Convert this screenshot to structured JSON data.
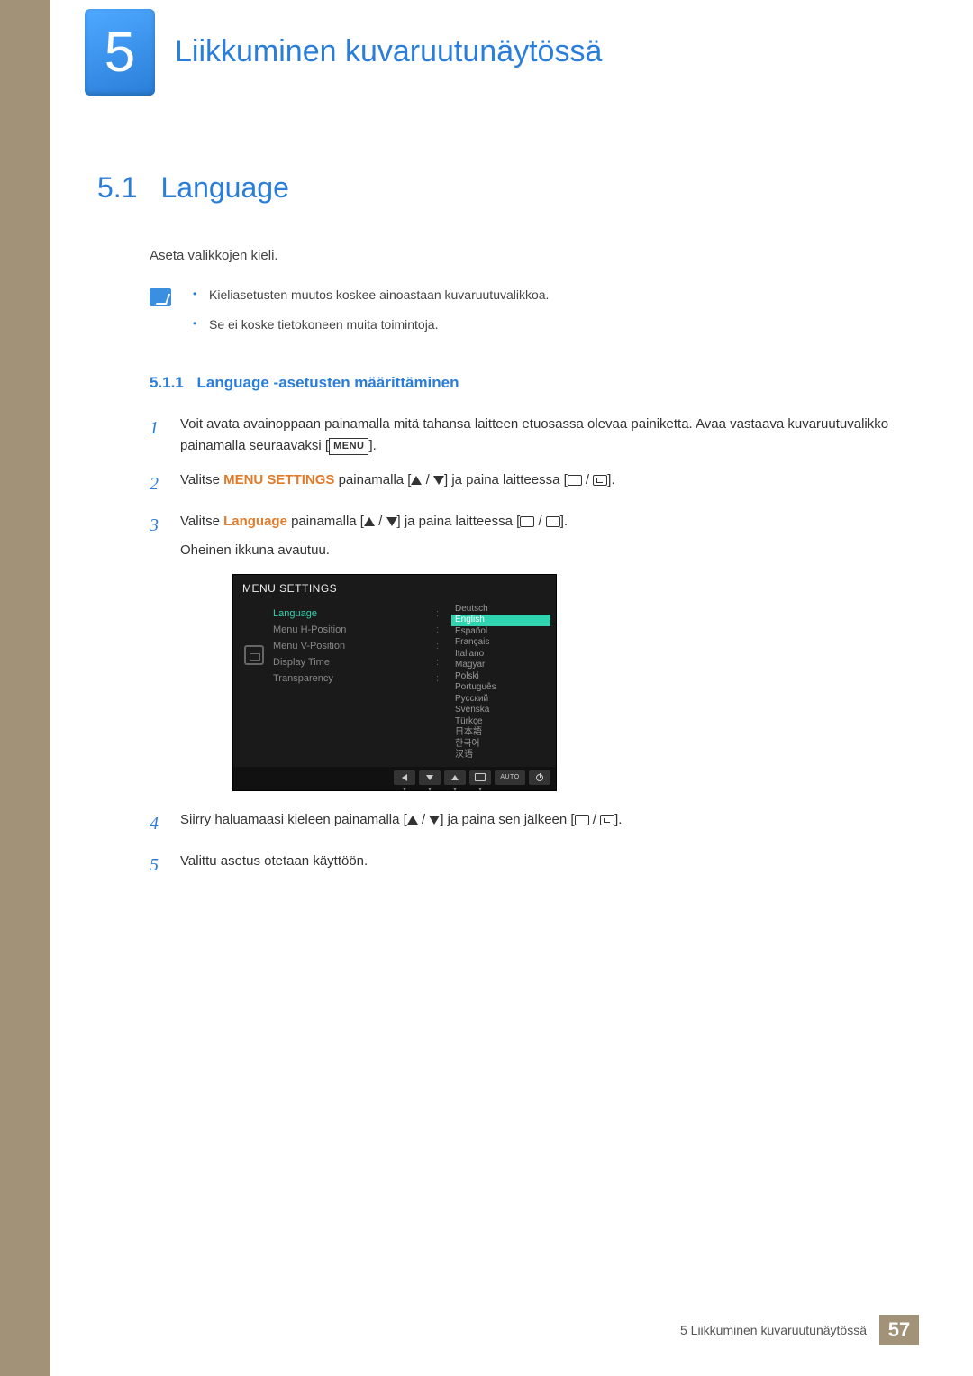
{
  "chapter": {
    "number": "5",
    "title": "Liikkuminen kuvaruutunäytössä"
  },
  "section": {
    "number": "5.1",
    "title": "Language"
  },
  "intro": "Aseta valikkojen kieli.",
  "notes": [
    "Kieliasetusten muutos koskee ainoastaan kuvaruutuvalikkoa.",
    "Se ei koske tietokoneen muita toimintoja."
  ],
  "subsection": {
    "number": "5.1.1",
    "title": "Language -asetusten määrittäminen"
  },
  "steps": {
    "s1a": "Voit avata avainoppaan painamalla mitä tahansa laitteen etuosassa olevaa painiketta. Avaa vastaava kuvaruutuvalikko painamalla seuraavaksi [",
    "s1b": "].",
    "menu_key": "MENU",
    "s2a": "Valitse ",
    "s2_bold": "MENU SETTINGS",
    "s2b": " painamalla [",
    "s2c": "] ja paina laitteessa [",
    "s2d": "].",
    "s3a": "Valitse ",
    "s3_bold": "Language",
    "s3b": " painamalla [",
    "s3c": "] ja paina laitteessa [",
    "s3d": "].",
    "s3e": "Oheinen ikkuna avautuu.",
    "s4a": "Siirry haluamaasi kieleen painamalla [",
    "s4b": "] ja paina sen jälkeen [",
    "s4c": "].",
    "s5": "Valittu asetus otetaan käyttöön."
  },
  "osd": {
    "title": "MENU SETTINGS",
    "items": [
      "Language",
      "Menu H-Position",
      "Menu V-Position",
      "Display Time",
      "Transparency"
    ],
    "langs": [
      "Deutsch",
      "English",
      "Español",
      "Français",
      "Italiano",
      "Magyar",
      "Polski",
      "Português",
      "Русский",
      "Svenska",
      "Türkçe",
      "日本語",
      "한국어",
      "汉语"
    ],
    "selected_lang_index": 1,
    "auto": "AUTO"
  },
  "footer": {
    "text": "5 Liikkuminen kuvaruutunäytössä",
    "page": "57"
  }
}
